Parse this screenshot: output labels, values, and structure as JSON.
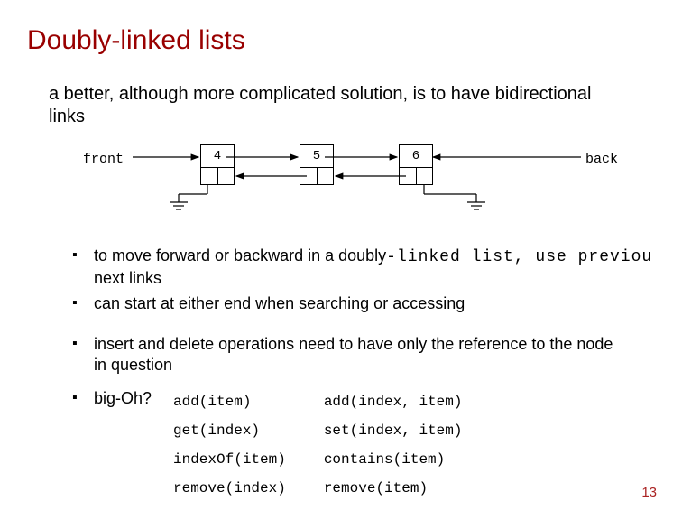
{
  "title": "Doubly-linked lists",
  "intro": "a better, although more complicated solution, is to have bidirectional links",
  "diagram": {
    "front_label": "front",
    "back_label": "back",
    "nodes": [
      "4",
      "5",
      "6"
    ]
  },
  "bullets_group1": [
    {
      "prefix": "to move forward or backward in a doubly",
      "mono": "-linked list, use previous &",
      "suffix": "next links"
    },
    {
      "prefix": "can start at either end when searching or accessing",
      "mono": "",
      "suffix": ""
    }
  ],
  "bullets_group2": [
    "insert and delete operations need to have only the reference to the node in question"
  ],
  "bigoh_label": "big-Oh?",
  "methods": {
    "col1": [
      "add(item)",
      "get(index)",
      "indexOf(item)",
      "remove(index)"
    ],
    "col2": [
      "add(index, item)",
      "set(index, item)",
      "contains(item)",
      "remove(item)"
    ]
  },
  "page_number": "13"
}
